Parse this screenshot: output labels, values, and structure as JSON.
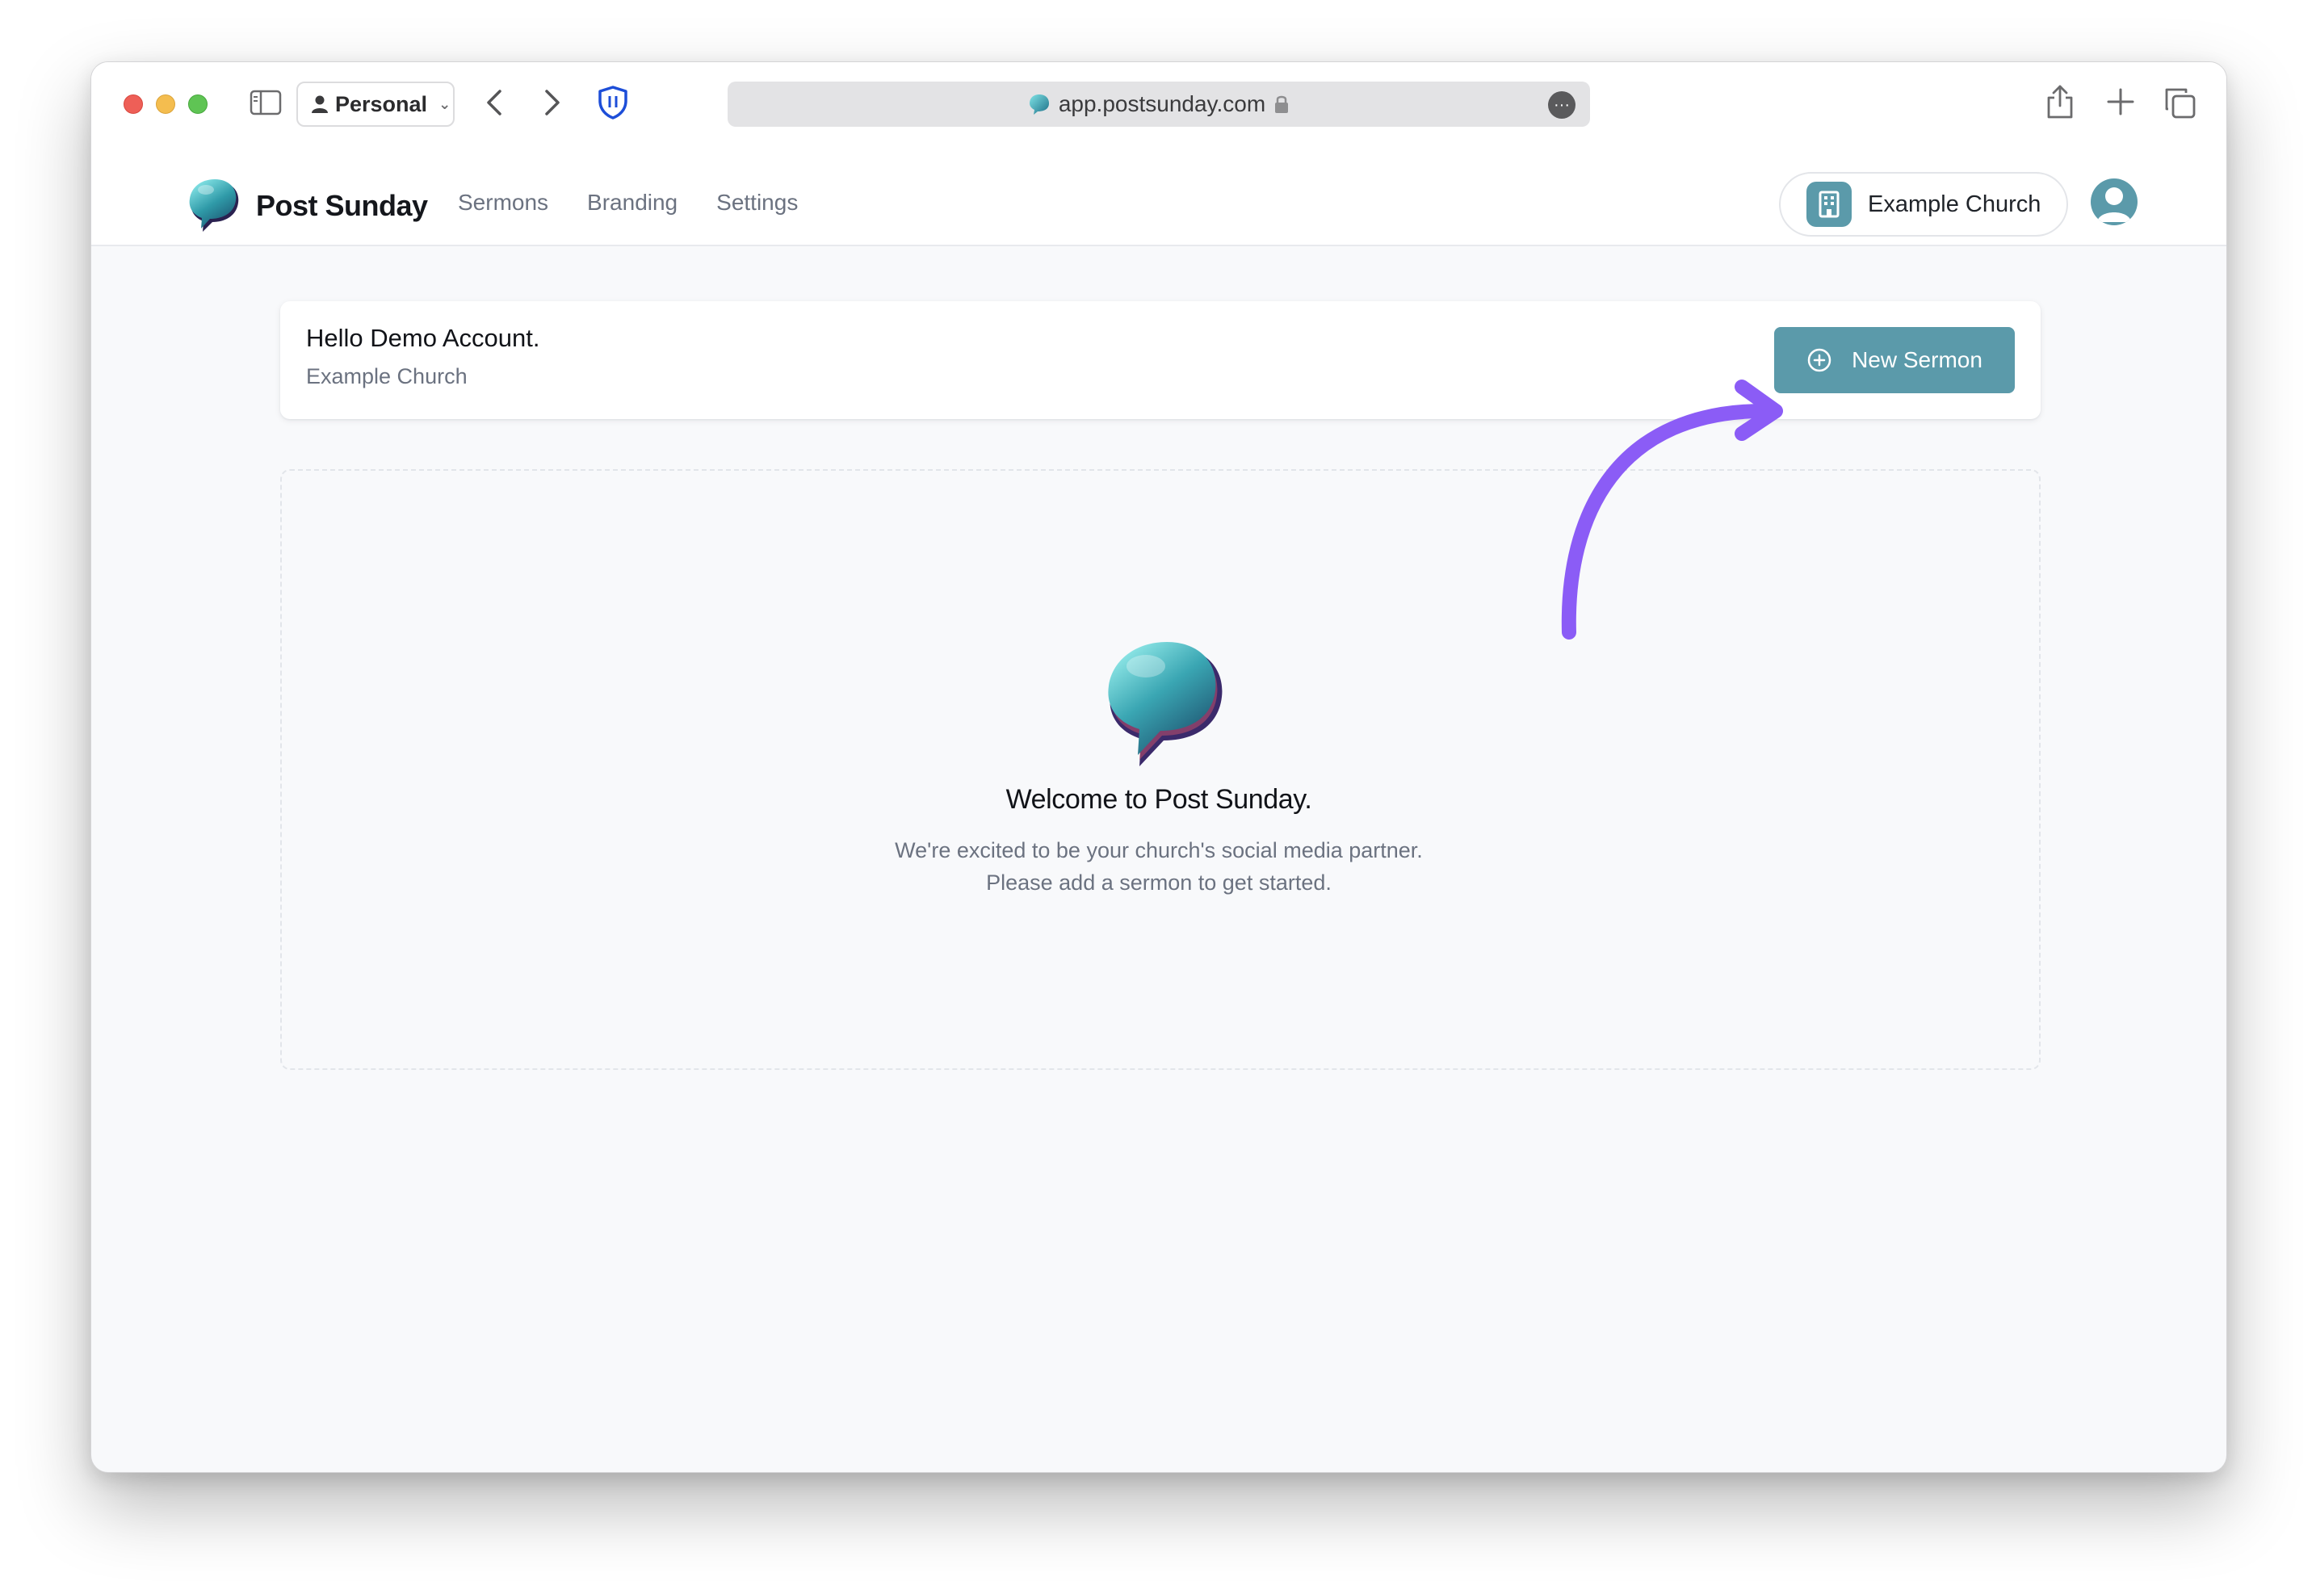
{
  "browser": {
    "profile_label": "Personal",
    "url": "app.postsunday.com"
  },
  "app": {
    "brand_name": "Post Sunday",
    "nav": [
      {
        "label": "Sermons"
      },
      {
        "label": "Branding"
      },
      {
        "label": "Settings"
      }
    ],
    "church_switcher_label": "Example Church"
  },
  "greeting": {
    "title": "Hello Demo Account.",
    "subtitle": "Example Church",
    "new_sermon_label": "New Sermon"
  },
  "empty_state": {
    "title": "Welcome to Post Sunday.",
    "line1": "We're excited to be your church's social media partner.",
    "line2": "Please add a sermon to get started."
  },
  "colors": {
    "accent": "#5b9aaa",
    "annotation_arrow": "#8b5cf6"
  }
}
